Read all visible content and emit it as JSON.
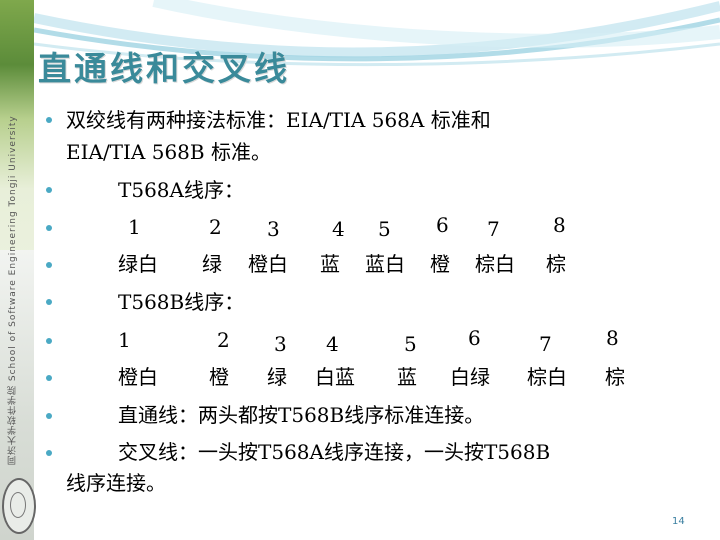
{
  "slide": {
    "title": "直通线和交叉线",
    "sidebar_text": "同济大学软件学院 School of Software Engineering Tongji University",
    "page_number": "14",
    "lines": {
      "l1a": "双绞线有两种接法标准：EIA/TIA 568A 标准和",
      "l1b": "EIA/TIA 568B 标准。",
      "l2": "T568A线序：",
      "l3": [
        "1",
        "2",
        "3",
        "4",
        "5",
        "6",
        "7",
        "8"
      ],
      "l4": [
        "绿白",
        "绿",
        "橙白",
        "蓝",
        "蓝白",
        "橙",
        "棕白",
        "棕"
      ],
      "l5": "T568B线序：",
      "l6": [
        "1",
        "2",
        "3",
        "4",
        "5",
        "6",
        "7",
        "8"
      ],
      "l7": [
        "橙白",
        "橙",
        "绿",
        "白蓝",
        "蓝",
        "白绿",
        "棕白",
        "棕"
      ],
      "l8": "直通线：两头都按T568B线序标准连接。",
      "l9a": "交叉线：一头按T568A线序连接，一头按T568B",
      "l9b": "线序连接。"
    }
  },
  "colors": {
    "title": "#3a8a9a",
    "bullet": "#4aa9c4",
    "swoosh": "#9fd3e2"
  }
}
